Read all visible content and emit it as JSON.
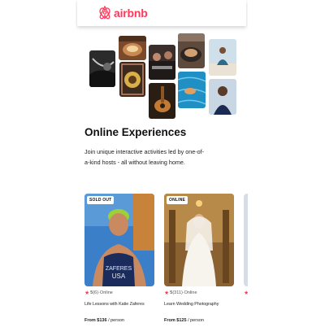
{
  "header": {
    "brand": "airbnb",
    "brand_color": "#ff385c",
    "logo_icon": "airbnb-belo-icon"
  },
  "hero": {
    "title": "Online Experiences",
    "description": "Join unique interactive activities led by one-of-a-kind hosts - all without leaving home."
  },
  "cards": [
    {
      "badge": "SOLD OUT",
      "rating": "5",
      "reviews": "(6)",
      "mode": "Online",
      "title": "Life Lessons with Katie Zaferes",
      "price_prefix": "From",
      "price": "$136",
      "price_unit": "/ person"
    },
    {
      "badge": "ONLINE",
      "rating": "5",
      "reviews": "(311)",
      "mode": "Online",
      "title": "Learn Wedding Photography",
      "price_prefix": "From",
      "price": "$125",
      "price_unit": "/ person"
    }
  ]
}
